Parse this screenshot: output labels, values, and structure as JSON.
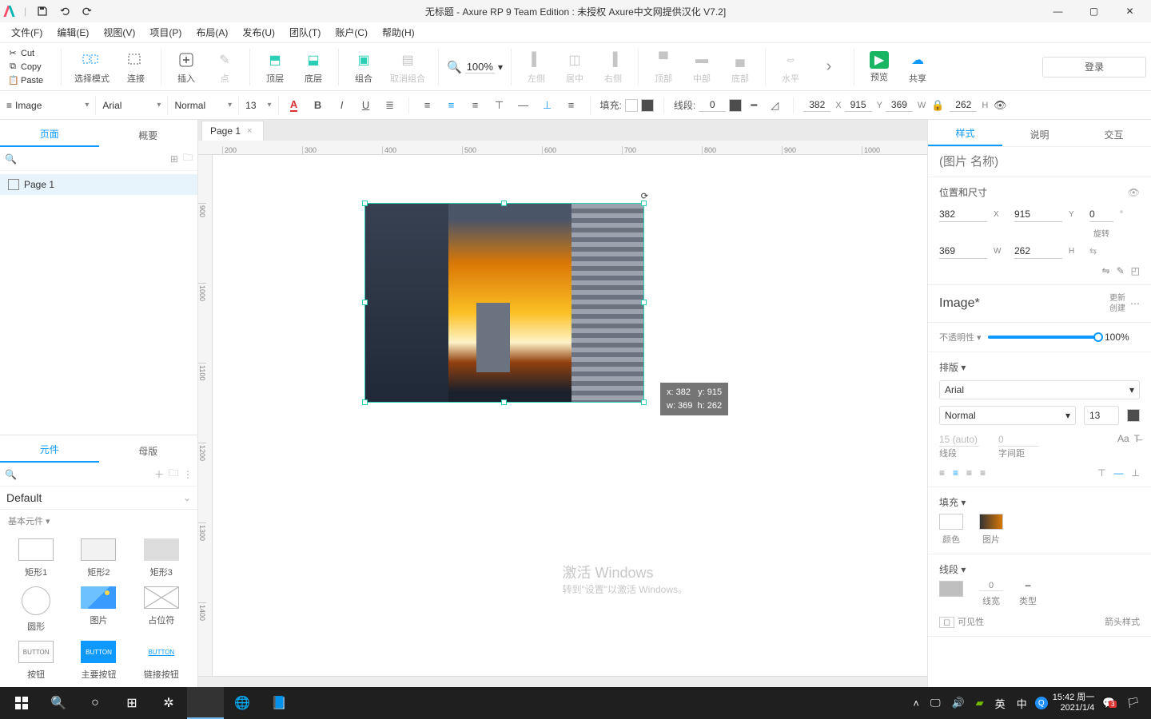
{
  "title": "无标题 - Axure RP 9 Team Edition : 未授权    Axure中文网提供汉化 V7.2]",
  "menus": {
    "file": "文件(F)",
    "edit": "编辑(E)",
    "view": "视图(V)",
    "project": "项目(P)",
    "layout": "布局(A)",
    "publish": "发布(U)",
    "team": "团队(T)",
    "account": "账户(C)",
    "help": "帮助(H)"
  },
  "clipboard": {
    "cut": "Cut",
    "copy": "Copy",
    "paste": "Paste"
  },
  "ribbon": {
    "select": "选择模式",
    "connect": "连接",
    "insert": "插入",
    "point": "点",
    "front": "顶层",
    "back": "底层",
    "group": "组合",
    "ungroup": "取消组合",
    "al": "左侧",
    "ac": "居中",
    "ar": "右侧",
    "at": "顶部",
    "am": "中部",
    "ab": "底部",
    "dh": "水平",
    "more": "›",
    "preview": "预览",
    "share": "共享",
    "login": "登录",
    "zoom": "100%"
  },
  "fmt": {
    "shape": "Image",
    "font": "Arial",
    "weight": "Normal",
    "size": "13",
    "fill": "填充:",
    "line": "线段:",
    "lineVal": "0",
    "x": "382",
    "y": "915",
    "w": "369",
    "h": "262"
  },
  "left": {
    "pages": "页面",
    "outline": "概要",
    "page1": "Page 1",
    "widgets": "元件",
    "masters": "母版",
    "lib": "Default",
    "basic": "基本元件 ▾",
    "r1": "矩形1",
    "r2": "矩形2",
    "r3": "矩形3",
    "circ": "圆形",
    "img": "图片",
    "ph": "占位符",
    "btn": "按钮",
    "pbtn": "主要按钮",
    "lbtn": "链接按钮",
    "btntxt": "BUTTON"
  },
  "canvas": {
    "tab": "Page 1",
    "tip": "x: 382   y: 915\nw: 369  h: 262",
    "ticks_h": [
      "200",
      "300",
      "400",
      "500",
      "600",
      "700",
      "800",
      "900",
      "1000"
    ],
    "ticks_v": [
      "900",
      "1000",
      "1100",
      "1200",
      "1300",
      "1400"
    ]
  },
  "right": {
    "style": "样式",
    "notes": "说明",
    "ix": "交互",
    "placeholder": "(图片 名称)",
    "posSize": "位置和尺寸",
    "rot": "旋转",
    "x": "382",
    "y": "915",
    "w": "369",
    "h": "262",
    "r": "0",
    "styleName": "Image*",
    "update": "更新",
    "create": "创建",
    "opacity": "不透明性 ▾",
    "opVal": "100%",
    "typo": "排版 ▾",
    "font": "Arial",
    "weight": "Normal",
    "size": "13",
    "lh": "15 (auto)",
    "ls": "0",
    "lhL": "线段",
    "lsL": "字间距",
    "fill": "填充 ▾",
    "color": "颜色",
    "image": "图片",
    "border": "线段 ▾",
    "bw": "0",
    "bwL": "线宽",
    "btL": "类型",
    "vis": "可见性",
    "arrow": "箭头样式"
  },
  "watermark": {
    "l1": "激活 Windows",
    "l2": "转到\"设置\"以激活 Windows。"
  },
  "taskbar": {
    "time": "15:42 周一",
    "date": "2021/1/4",
    "badge": "3"
  }
}
